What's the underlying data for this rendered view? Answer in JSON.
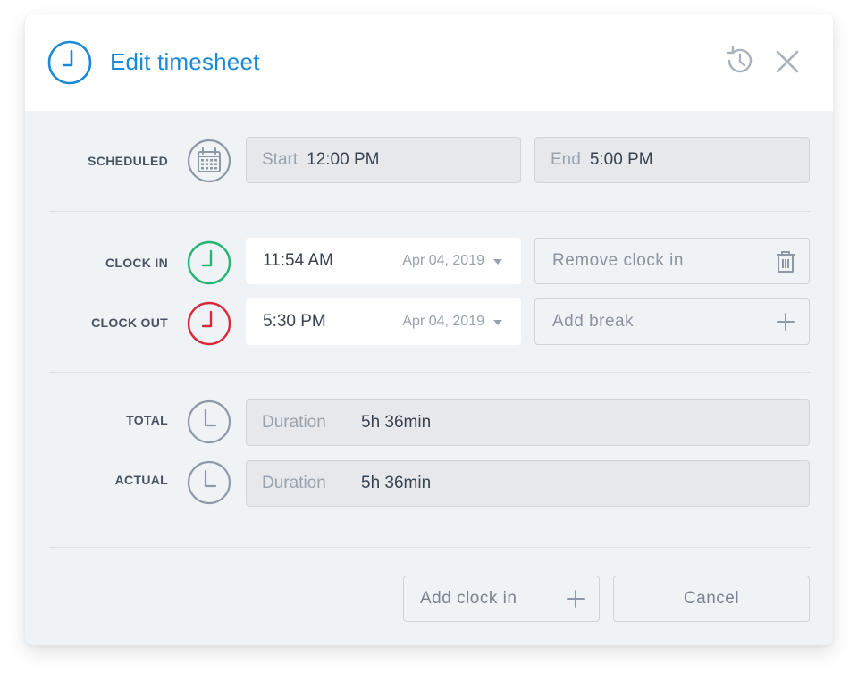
{
  "header": {
    "title": "Edit timesheet",
    "title_icon": "clock-icon",
    "history_icon": "history-icon",
    "close_icon": "close-icon",
    "accent": "#1a8ad8"
  },
  "scheduled": {
    "label": "SCHEDULED",
    "icon": "calendar-icon",
    "start_label": "Start",
    "start_value": "12:00 PM",
    "end_label": "End",
    "end_value": "5:00 PM"
  },
  "clock_in": {
    "label": "CLOCK IN",
    "icon": "clock-in-icon",
    "icon_color": "#22b573",
    "time": "11:54 AM",
    "date": "Apr 04, 2019",
    "action_label": "Remove clock in",
    "action_icon": "trash-icon"
  },
  "clock_out": {
    "label": "CLOCK OUT",
    "icon": "clock-out-icon",
    "icon_color": "#d8283a",
    "time": "5:30 PM",
    "date": "Apr 04, 2019",
    "action_label": "Add break",
    "action_icon": "plus-icon"
  },
  "total": {
    "label": "TOTAL",
    "icon": "clock-icon",
    "duration_label": "Duration",
    "duration_value": "5h 36min"
  },
  "actual": {
    "label": "ACTUAL",
    "icon": "clock-icon",
    "duration_label": "Duration",
    "duration_value": "5h 36min"
  },
  "footer": {
    "add_clock_in_label": "Add clock in",
    "add_clock_in_icon": "plus-icon",
    "cancel_label": "Cancel"
  }
}
